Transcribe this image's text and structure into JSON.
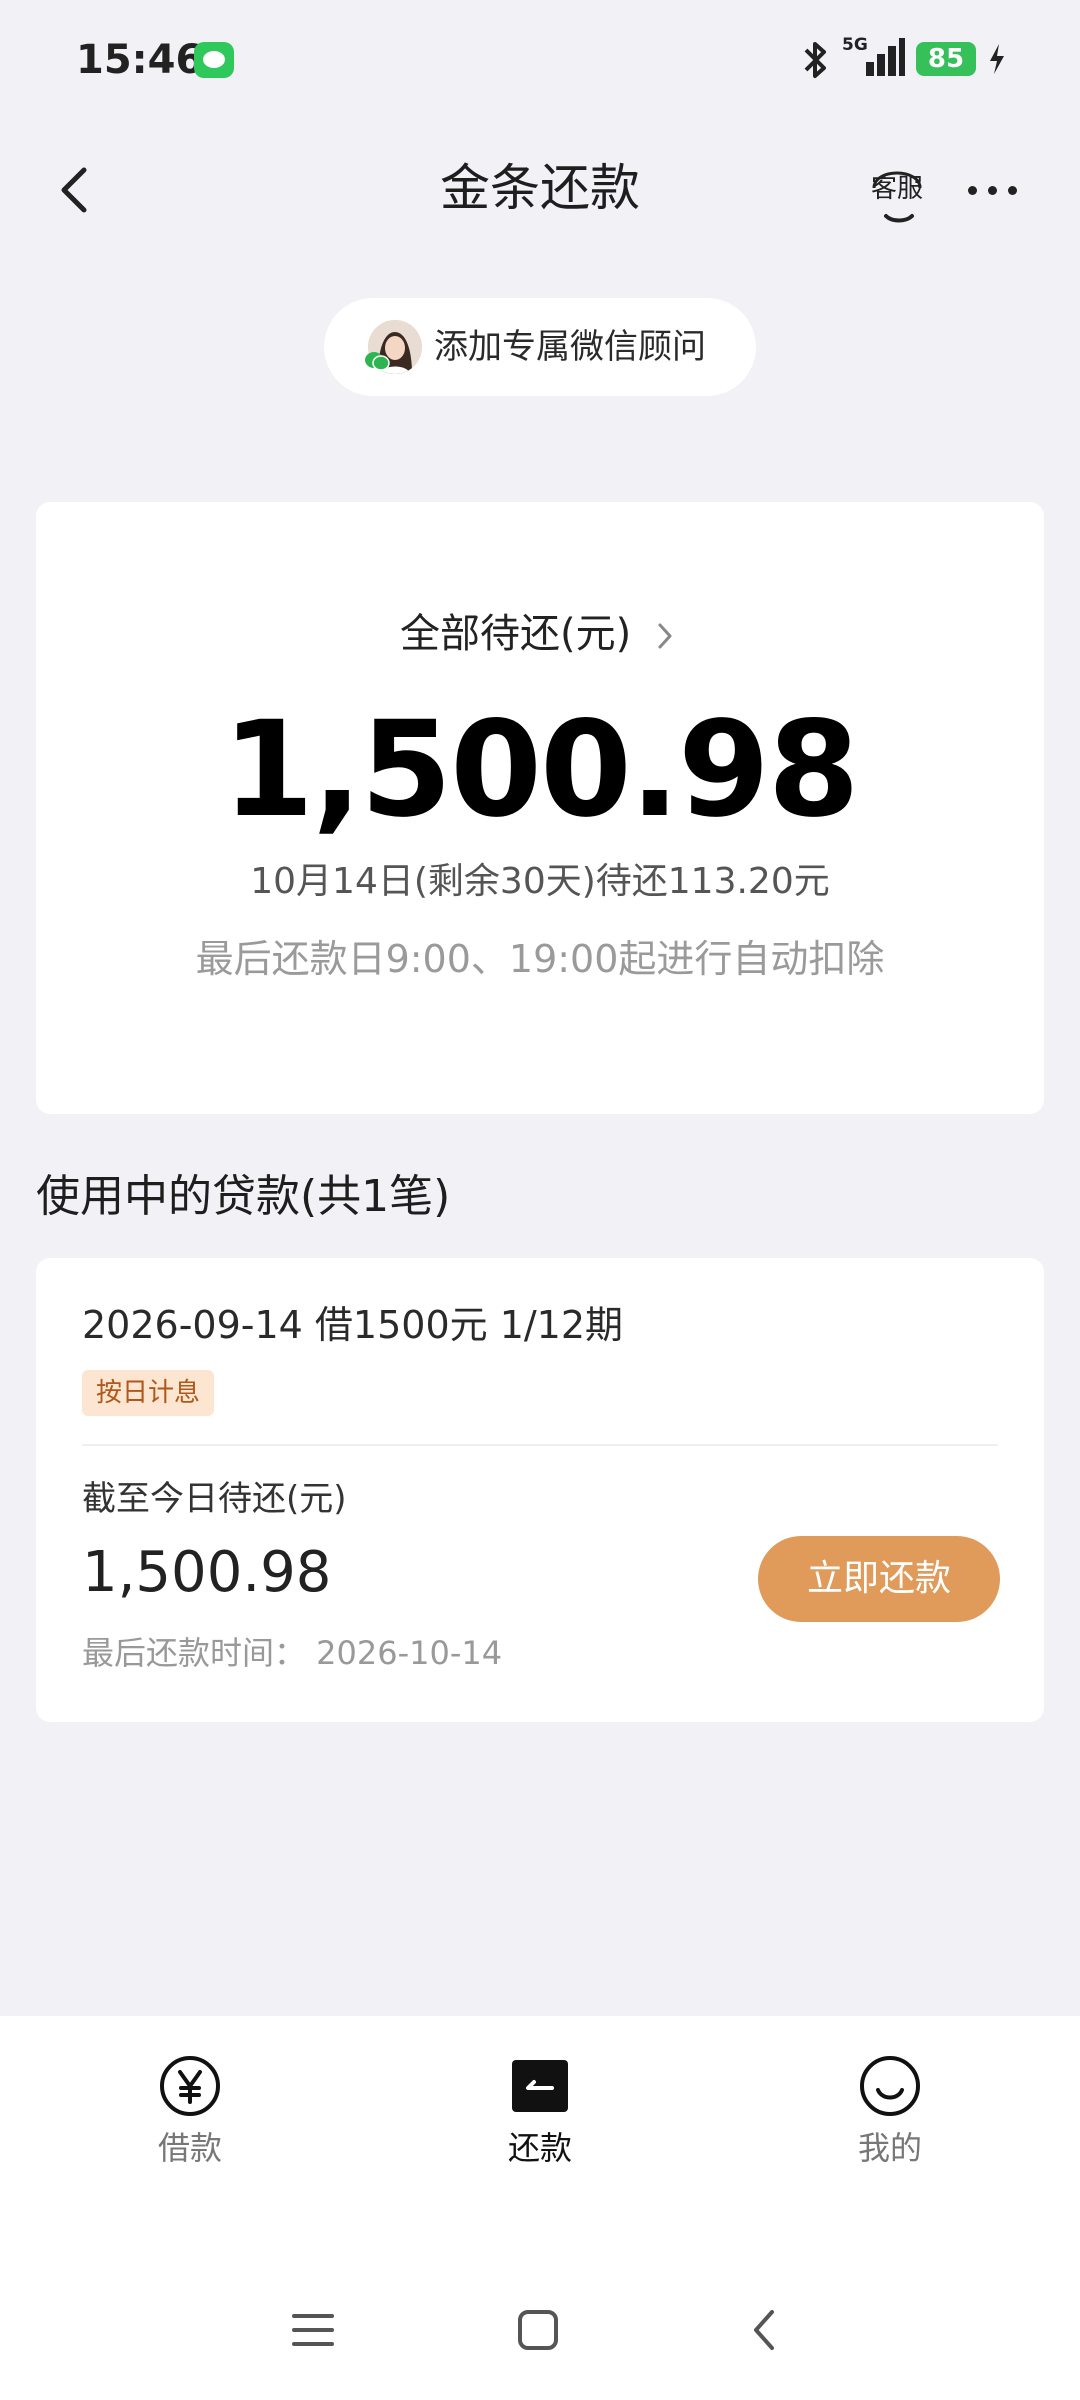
{
  "status_bar": {
    "time": "15:46",
    "icons": [
      "message-icon",
      "bluetooth-icon",
      "5g-signal-icon",
      "battery-icon",
      "charging-icon"
    ],
    "network": "5G",
    "battery": "85"
  },
  "header": {
    "title": "金条还款",
    "service_label": "客服",
    "icons": [
      "back-icon",
      "headset-icon",
      "more-icon"
    ]
  },
  "advisor": {
    "label": "添加专属微信顾问"
  },
  "summary": {
    "total_label": "全部待还(元)",
    "total_amount": "1,500.98",
    "due_line": "10月14日(剩余30天)待还113.20元",
    "auto_line": "最后还款日9:00、19:00起进行自动扣除"
  },
  "loans_section": {
    "title": "使用中的贷款(共1笔)"
  },
  "loan": {
    "title": "2026-09-14 借1500元 1/12期",
    "tag": "按日计息",
    "due_today_label": "截至今日待还(元)",
    "due_today_amount": "1,500.98",
    "last_date": "最后还款时间：  2026-10-14",
    "repay_button": "立即还款"
  },
  "bottom_nav": {
    "items": [
      {
        "label": "借款",
        "icon": "yuan-icon"
      },
      {
        "label": "还款",
        "icon": "repay-icon"
      },
      {
        "label": "我的",
        "icon": "smile-icon"
      }
    ],
    "active_index": 1
  },
  "system_nav": {
    "icons": [
      "menu-icon",
      "home-icon",
      "back-icon"
    ]
  },
  "colors": {
    "background": "#f1f1f6",
    "accent_button": "#e09a5a",
    "tag_background": "#fce6d2",
    "tag_text": "#b0581c",
    "battery": "#35c05a"
  }
}
